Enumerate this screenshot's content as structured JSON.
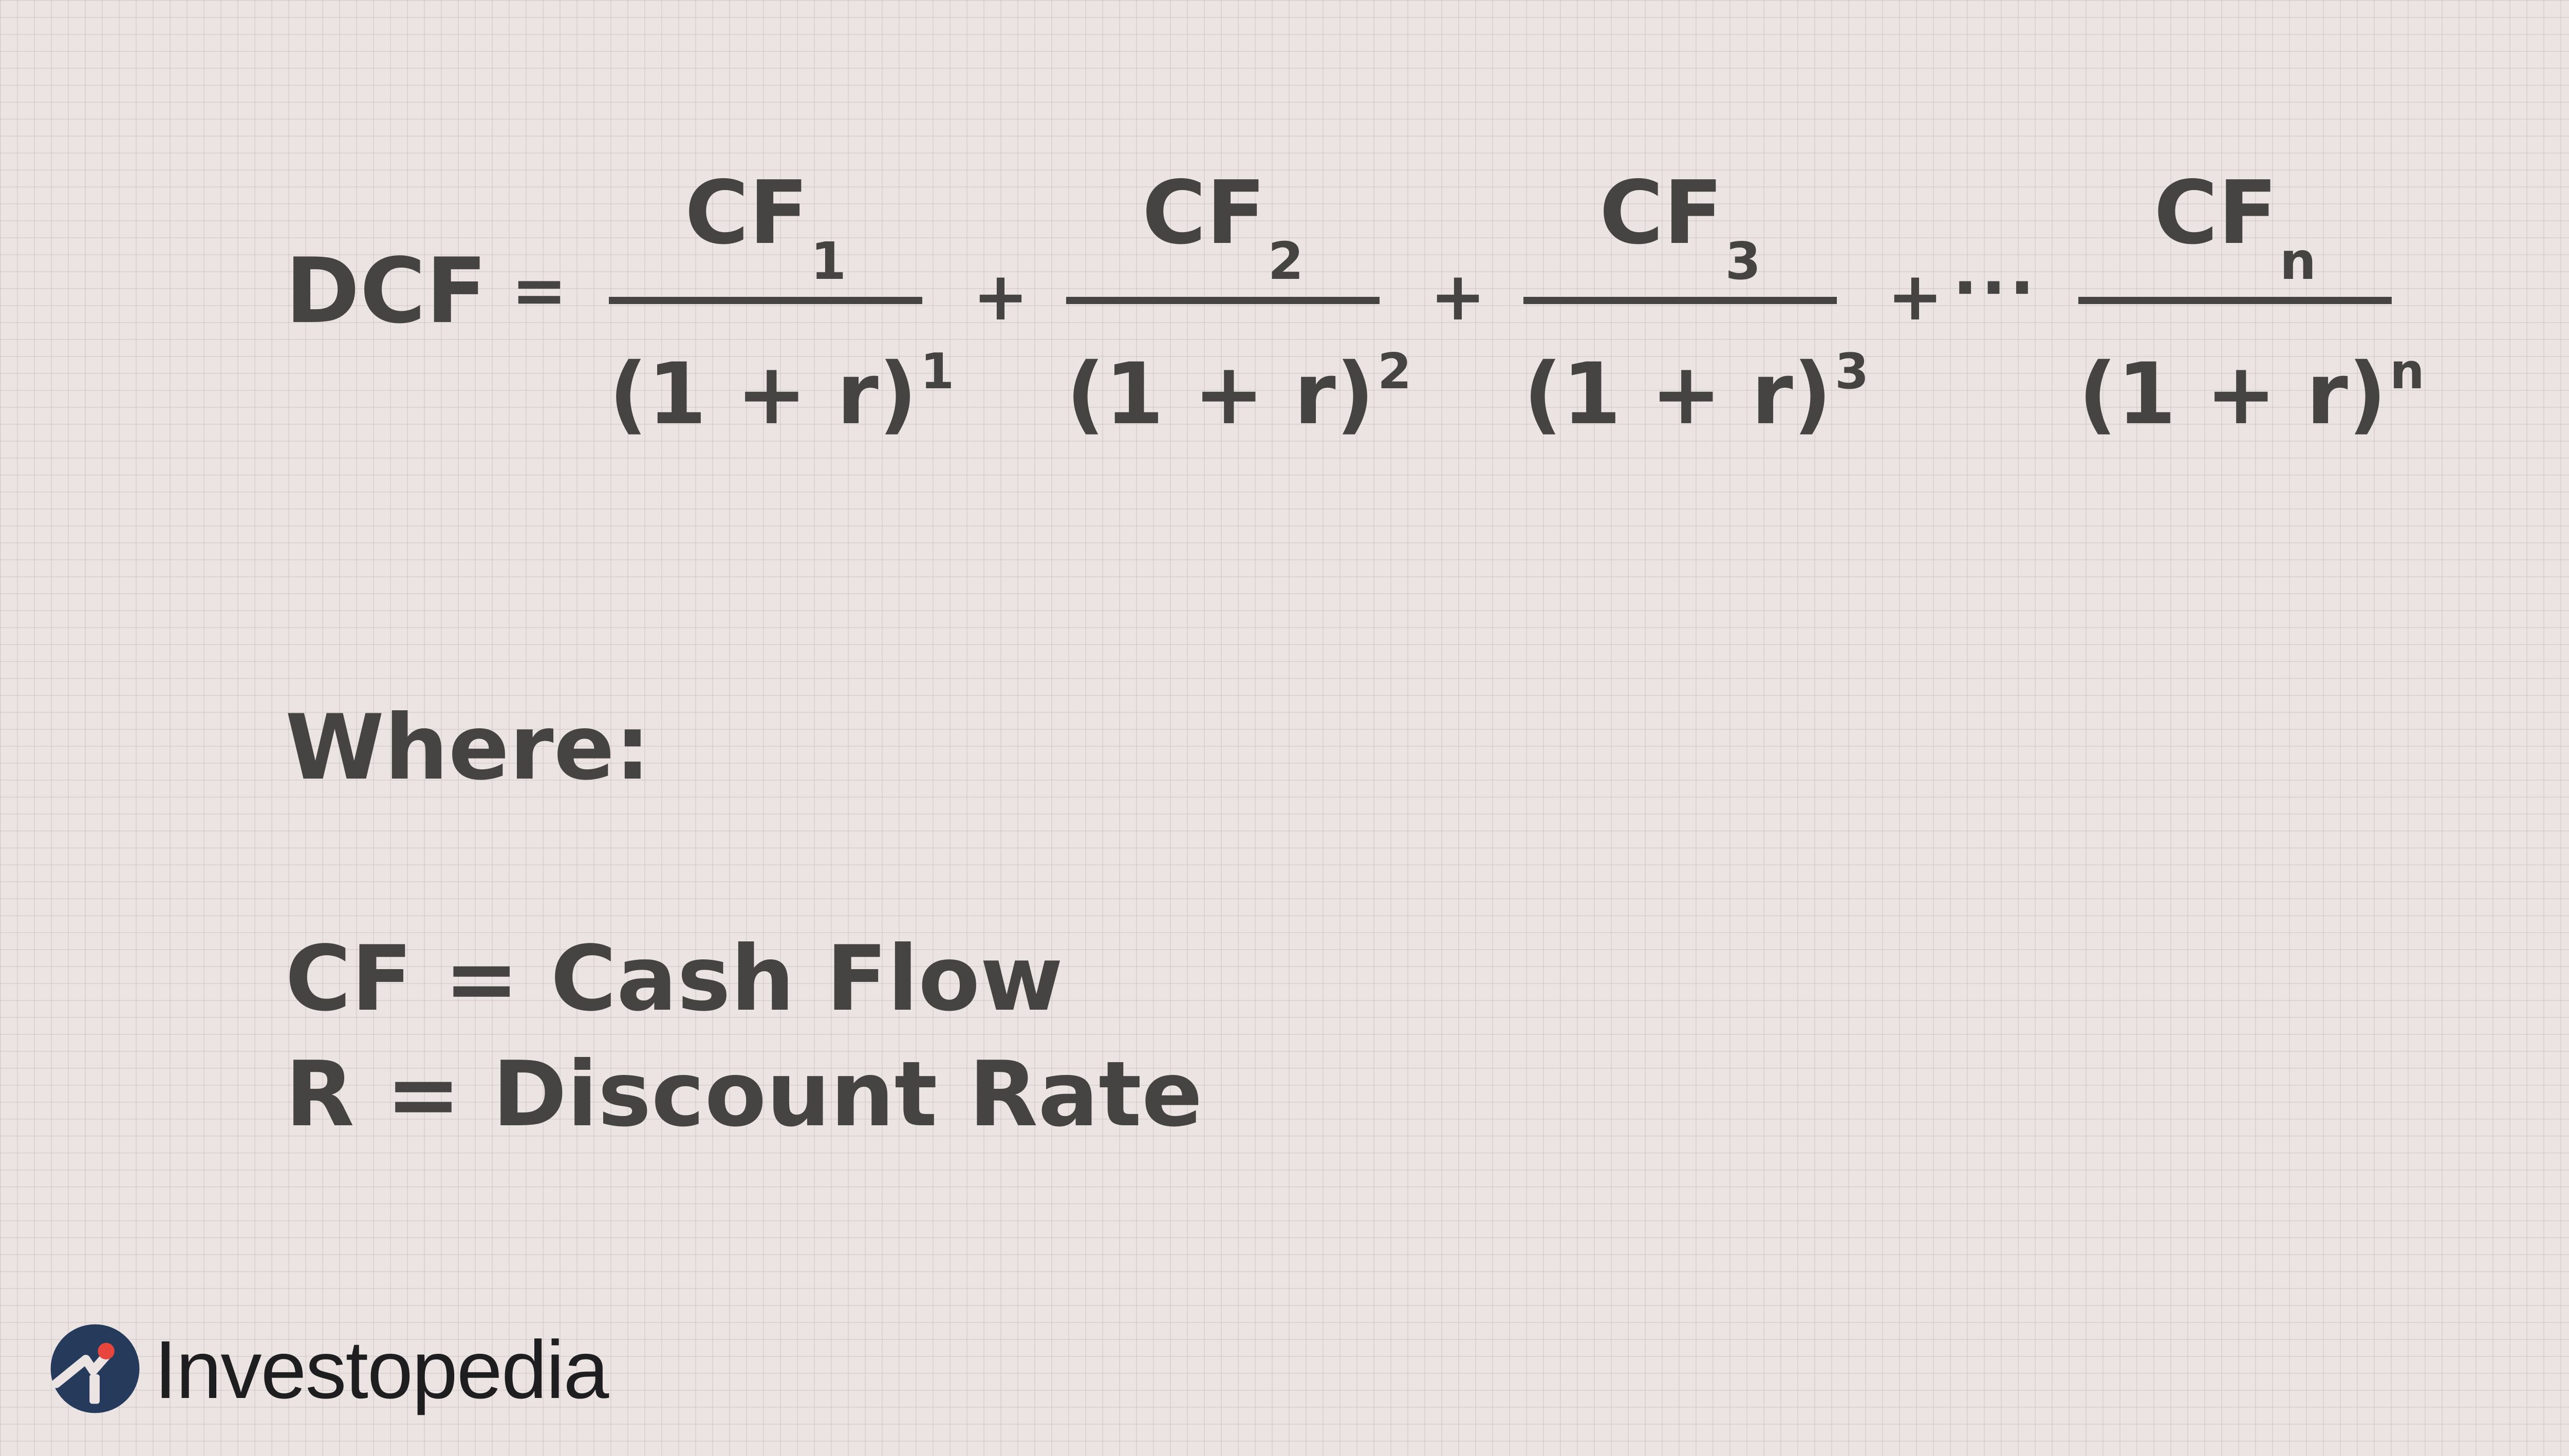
{
  "formula": {
    "lhs": "DCF",
    "equals": "=",
    "plus": "+",
    "ellipsis": "···",
    "terms": [
      {
        "numerator_base": "CF",
        "numerator_sub": "1",
        "denominator_base": "(1 + r)",
        "denominator_exp": "1"
      },
      {
        "numerator_base": "CF",
        "numerator_sub": "2",
        "denominator_base": "(1 + r)",
        "denominator_exp": "2"
      },
      {
        "numerator_base": "CF",
        "numerator_sub": "3",
        "denominator_base": "(1 + r)",
        "denominator_exp": "3"
      },
      {
        "numerator_base": "CF",
        "numerator_sub": "n",
        "denominator_base": "(1 + r)",
        "denominator_exp": "n"
      }
    ]
  },
  "legend": {
    "heading": "Where:",
    "definitions": [
      "CF = Cash Flow",
      "R = Discount Rate"
    ]
  },
  "logo": {
    "brand": "Investopedia",
    "icon": "investopedia-logo-icon",
    "icon_color": "#263a5c",
    "accent_color": "#e8453c"
  }
}
